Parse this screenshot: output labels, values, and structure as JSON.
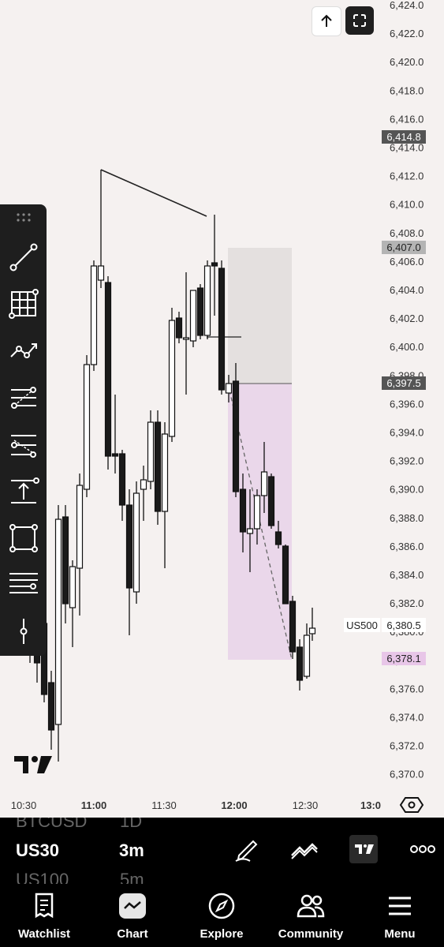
{
  "chart": {
    "symbol_tag": "US500",
    "price_axis": [
      "6,424.0",
      "6,422.0",
      "6,420.0",
      "6,418.0",
      "6,416.0",
      "6,414.0",
      "6,412.0",
      "6,410.0",
      "6,408.0",
      "6,406.0",
      "6,404.0",
      "6,402.0",
      "6,400.0",
      "6,398.0",
      "6,396.0",
      "6,394.0",
      "6,392.0",
      "6,390.0",
      "6,388.0",
      "6,386.0",
      "6,384.0",
      "6,382.0",
      "6,380.0",
      "6,378.0",
      "6,376.0",
      "6,374.0",
      "6,372.0",
      "6,370.0"
    ],
    "time_axis": [
      "10:30",
      "11:00",
      "11:30",
      "12:00",
      "12:30",
      "13:0"
    ],
    "badges": {
      "top": "6,414.8",
      "risk_top": "6,407.0",
      "entry": "6,397.5",
      "current": "6,380.5",
      "target": "6,378.1"
    },
    "colors": {
      "background": "#f5f1f0",
      "stop_zone": "#e4e0df",
      "target_zone": "#ead7ea",
      "badge_dark": "#555555",
      "badge_gray": "#b4b4b4",
      "badge_pink": "#e8c6e8"
    }
  },
  "top_buttons": {
    "scroll_icon": "arrow-up-icon",
    "fullscreen_icon": "fullscreen-icon"
  },
  "toolbar": {
    "tools": [
      "drag-handle-icon",
      "trend-line-icon",
      "grid-icon",
      "path-icon",
      "fib-retracement-icon",
      "fib-extension-icon",
      "long-position-icon",
      "rectangle-icon",
      "horizontal-lines-icon",
      "vertical-line-icon"
    ]
  },
  "symbol_bar": {
    "prev_symbol": "BTCUSD",
    "prev_interval": "1D",
    "symbol": "US30",
    "interval": "3m",
    "next_symbol": "US100",
    "next_interval": "5m"
  },
  "nav": {
    "items": [
      {
        "label": "Watchlist"
      },
      {
        "label": "Chart"
      },
      {
        "label": "Explore"
      },
      {
        "label": "Community"
      },
      {
        "label": "Menu"
      }
    ]
  }
}
